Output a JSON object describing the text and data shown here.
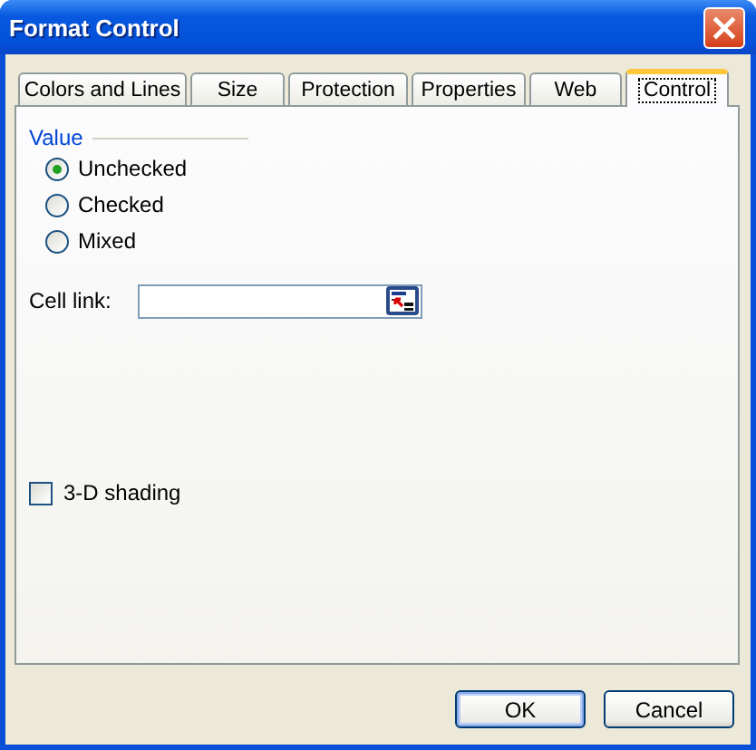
{
  "window": {
    "title": "Format Control"
  },
  "tabs": [
    {
      "label": "Colors and Lines",
      "selected": false
    },
    {
      "label": "Size",
      "selected": false
    },
    {
      "label": "Protection",
      "selected": false
    },
    {
      "label": "Properties",
      "selected": false
    },
    {
      "label": "Web",
      "selected": false
    },
    {
      "label": "Control",
      "selected": true
    }
  ],
  "value_group": {
    "label": "Value",
    "options": [
      {
        "label": "Unchecked",
        "selected": true
      },
      {
        "label": "Checked",
        "selected": false
      },
      {
        "label": "Mixed",
        "selected": false
      }
    ]
  },
  "cell_link": {
    "label": "Cell link:"
  },
  "shading": {
    "label": "3-D shading",
    "checked": false
  },
  "buttons": [
    "OK",
    "Cancel"
  ]
}
